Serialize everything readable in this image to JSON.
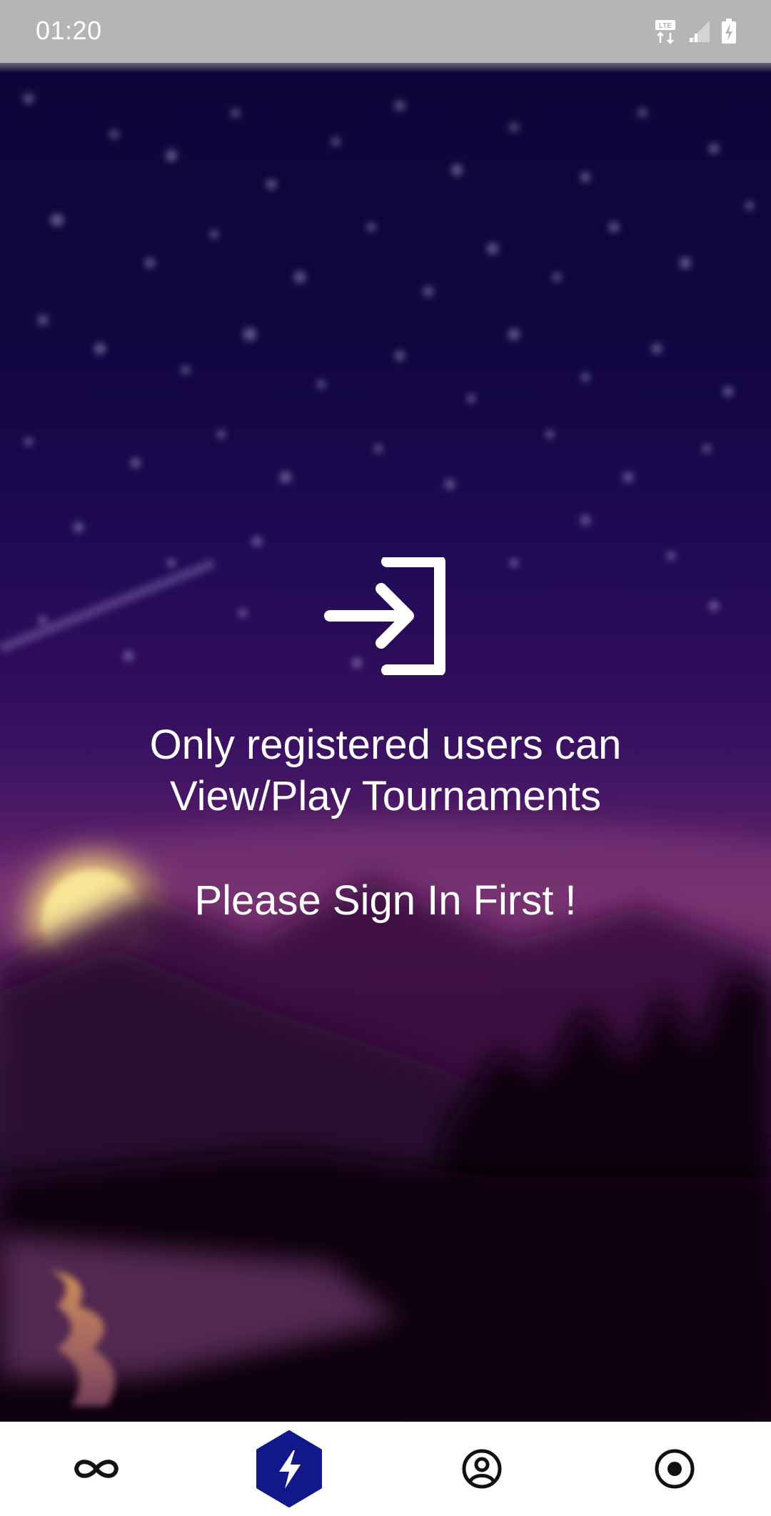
{
  "status_bar": {
    "time": "01:20",
    "icons": [
      "lte-icon",
      "signal-icon",
      "battery-charging-icon"
    ],
    "lte_label": "LTE"
  },
  "main": {
    "icon": "sign-in-icon",
    "message_line1": "Only registered users can",
    "message_line2": "View/Play Tournaments",
    "prompt": "Please Sign In First !"
  },
  "bottom_nav": {
    "items": [
      {
        "name": "infinity-icon",
        "active": false
      },
      {
        "name": "lightning-icon",
        "active": true
      },
      {
        "name": "user-circle-icon",
        "active": false
      },
      {
        "name": "radio-target-icon",
        "active": false
      }
    ],
    "active_color": "#10188a"
  },
  "colors": {
    "status_bar_bg": "#b5b5b5",
    "nav_bg": "#ffffff",
    "text": "#ffffff"
  }
}
